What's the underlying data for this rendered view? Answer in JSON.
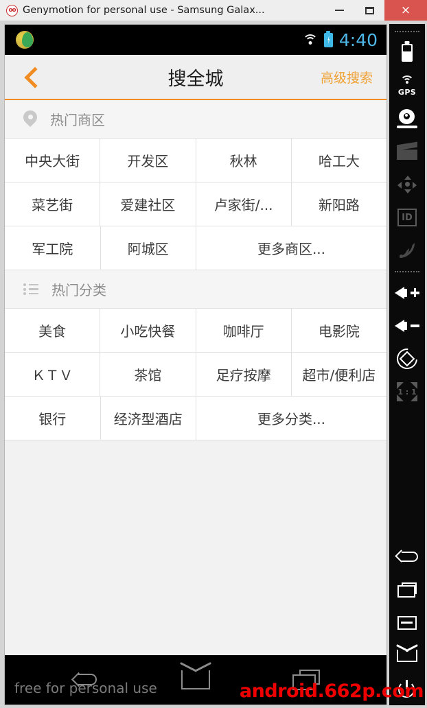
{
  "titlebar": {
    "title": "Genymotion for personal use - Samsung Galax...",
    "logo_icon": "genymotion-logo",
    "minimize_label": "",
    "maximize_label": "",
    "close_label": "×"
  },
  "statusbar": {
    "app_icon": "app-launcher-icon",
    "wifi_icon": "wifi-icon",
    "battery_icon": "battery-charging-icon",
    "time": "4:40"
  },
  "app_header": {
    "back_icon": "back-chevron-icon",
    "title": "搜全城",
    "advanced_search": "高级搜索",
    "accent_color": "#f08c22"
  },
  "sections": [
    {
      "id": "districts",
      "icon": "map-pin-icon",
      "label": "热门商区",
      "rows": [
        [
          {
            "label": "中央大街",
            "span": 1
          },
          {
            "label": "开发区",
            "span": 1
          },
          {
            "label": "秋林",
            "span": 1
          },
          {
            "label": "哈工大",
            "span": 1
          }
        ],
        [
          {
            "label": "菜艺街",
            "span": 1
          },
          {
            "label": "爱建社区",
            "span": 1
          },
          {
            "label": "卢家街/...",
            "span": 1
          },
          {
            "label": "新阳路",
            "span": 1
          }
        ],
        [
          {
            "label": "军工院",
            "span": 1
          },
          {
            "label": "阿城区",
            "span": 1
          },
          {
            "label": "更多商区...",
            "span": 2
          }
        ]
      ]
    },
    {
      "id": "categories",
      "icon": "bullet-list-icon",
      "label": "热门分类",
      "rows": [
        [
          {
            "label": "美食",
            "span": 1
          },
          {
            "label": "小吃快餐",
            "span": 1
          },
          {
            "label": "咖啡厅",
            "span": 1
          },
          {
            "label": "电影院",
            "span": 1
          }
        ],
        [
          {
            "label": "ＫＴＶ",
            "span": 1
          },
          {
            "label": "茶馆",
            "span": 1
          },
          {
            "label": "足疗按摩",
            "span": 1
          },
          {
            "label": "超市/便利店",
            "span": 1
          }
        ],
        [
          {
            "label": "银行",
            "span": 1
          },
          {
            "label": "经济型酒店",
            "span": 1
          },
          {
            "label": "更多分类...",
            "span": 2
          }
        ]
      ]
    }
  ],
  "navbar": {
    "back_icon": "nav-back-icon",
    "home_icon": "nav-home-icon",
    "recents_icon": "nav-recents-icon",
    "watermark_free": "free for personal use",
    "watermark_site": "android.662p.com",
    "watermark_site_color": "#ee0000"
  },
  "toolbar": {
    "items": [
      {
        "icon": "battery-widget-icon",
        "label": ""
      },
      {
        "icon": "gps-icon",
        "label": "GPS"
      },
      {
        "icon": "camera-icon",
        "label": ""
      },
      {
        "icon": "video-recorder-icon",
        "label": ""
      },
      {
        "icon": "dpad-icon",
        "label": ""
      },
      {
        "icon": "identifiers-icon",
        "label": "ID"
      },
      {
        "icon": "network-signal-icon",
        "label": ""
      },
      {
        "icon": "volume-up-icon",
        "label": ""
      },
      {
        "icon": "volume-down-icon",
        "label": ""
      },
      {
        "icon": "rotate-screen-icon",
        "label": ""
      },
      {
        "icon": "scale-one-to-one-icon",
        "label": "1 : 1"
      },
      {
        "icon": "nav-back-icon",
        "label": ""
      },
      {
        "icon": "nav-recents-icon",
        "label": ""
      },
      {
        "icon": "nav-menu-icon",
        "label": ""
      },
      {
        "icon": "nav-home-icon",
        "label": ""
      },
      {
        "icon": "power-icon",
        "label": ""
      }
    ]
  }
}
